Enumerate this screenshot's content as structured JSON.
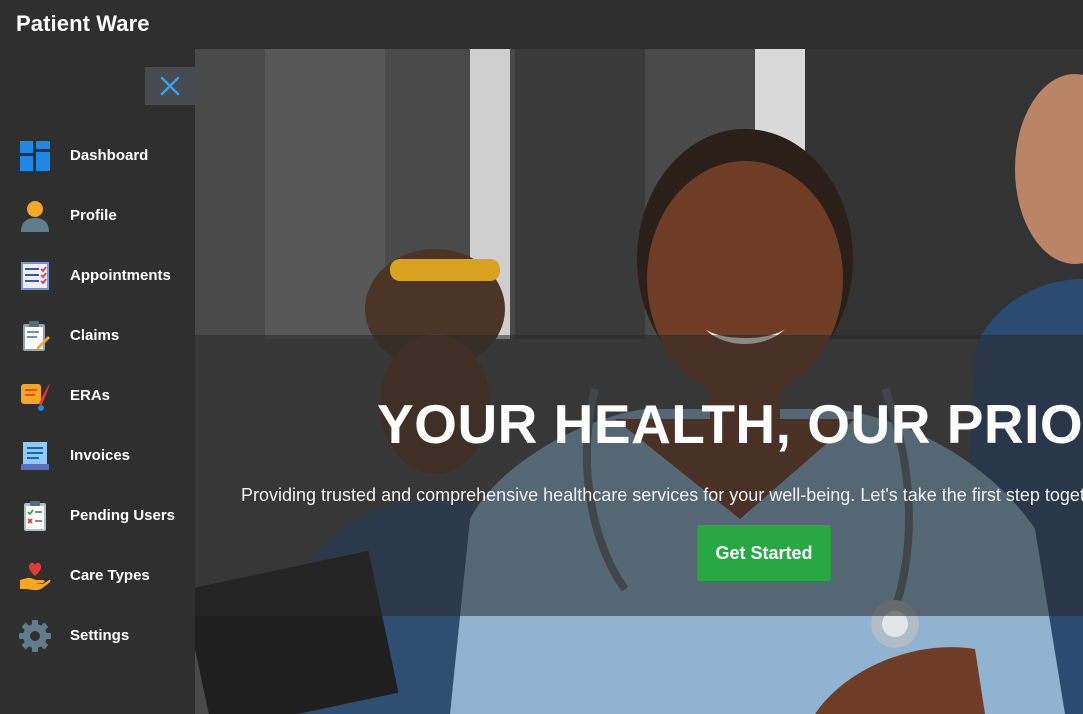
{
  "app": {
    "title": "Patient Ware"
  },
  "sidebar": {
    "close_icon": "close-icon",
    "items": [
      {
        "label": "Dashboard",
        "icon": "dashboard-icon"
      },
      {
        "label": "Profile",
        "icon": "user-icon"
      },
      {
        "label": "Appointments",
        "icon": "checklist-icon"
      },
      {
        "label": "Claims",
        "icon": "clipboard-edit-icon"
      },
      {
        "label": "ERAs",
        "icon": "scroll-quill-icon"
      },
      {
        "label": "Invoices",
        "icon": "invoice-icon"
      },
      {
        "label": "Pending Users",
        "icon": "pending-list-icon"
      },
      {
        "label": "Care Types",
        "icon": "hand-heart-icon"
      },
      {
        "label": "Settings",
        "icon": "gear-icon"
      }
    ]
  },
  "hero": {
    "title": "YOUR HEALTH, OUR PRIORITY",
    "subtitle": "Providing trusted and comprehensive healthcare services for your well-being. Let's take the first step together.",
    "cta_label": "Get Started"
  },
  "colors": {
    "accent": "#28a745",
    "sidebar_bg": "#2f2f2f",
    "close_bg": "#474a4f",
    "close_x": "#3a9ee6"
  }
}
